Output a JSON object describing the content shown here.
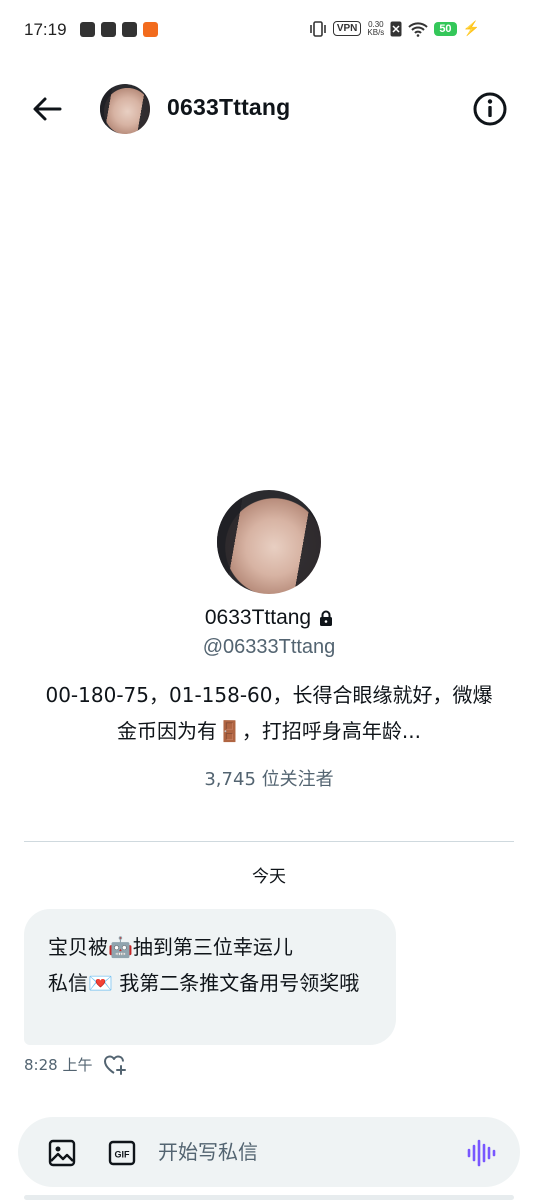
{
  "status_bar": {
    "time": "17:19",
    "vpn": "VPN",
    "speed_value": "0.30",
    "speed_unit": "KB/s",
    "battery": "50"
  },
  "header": {
    "name": "0633Tttang"
  },
  "profile": {
    "name": "0633Tttang",
    "handle": "@06333Tttang",
    "bio": "00-180-75，01-158-60，长得合眼缘就好，微爆金币因为有🚪，打招呼身高年龄...",
    "followers": "3,745 位关注者"
  },
  "conversation": {
    "date_label": "今天",
    "message_text": "宝贝被🤖抽到第三位幸运儿\n私信💌 我第二条推文备用号领奖哦",
    "message_time": "8:28 上午"
  },
  "composer": {
    "placeholder": "开始写私信",
    "gif_label": "GIF"
  },
  "colors": {
    "accent": "#1d9bf0",
    "voice": "#7856ff",
    "muted_text": "#536471",
    "bubble_bg": "#eff3f4"
  },
  "icons": [
    "back-arrow-icon",
    "info-icon",
    "lock-icon",
    "heart-add-icon",
    "image-icon",
    "gif-icon",
    "voice-icon"
  ]
}
